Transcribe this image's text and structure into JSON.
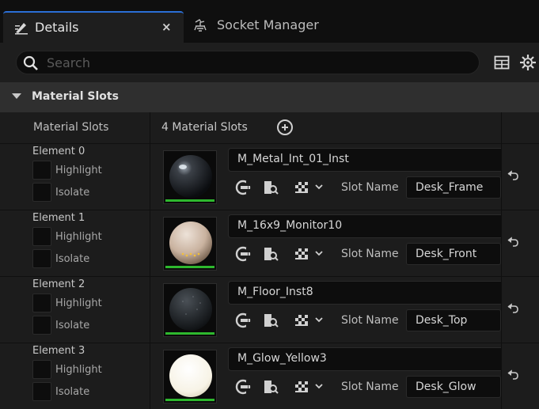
{
  "tabs": {
    "details_label": "Details",
    "close_glyph": "×",
    "socket_label": "Socket Manager"
  },
  "search": {
    "placeholder": "Search"
  },
  "category": {
    "label": "Material Slots"
  },
  "slots_row": {
    "label": "Material Slots",
    "value": "4 Material Slots"
  },
  "checkbox_labels": {
    "highlight": "Highlight",
    "isolate": "Isolate"
  },
  "slot_name_label": "Slot Name",
  "elements": [
    {
      "name": "Element 0",
      "material": "M_Metal_Int_01_Inst",
      "slot": "Desk_Frame"
    },
    {
      "name": "Element 1",
      "material": "M_16x9_Monitor10",
      "slot": "Desk_Front"
    },
    {
      "name": "Element 2",
      "material": "M_Floor_Inst8",
      "slot": "Desk_Top"
    },
    {
      "name": "Element 3",
      "material": "M_Glow_Yellow3",
      "slot": "Desk_Glow"
    }
  ],
  "colors": {
    "accent_tab": "#2b6fd6",
    "asset_bar": "#2eb82e"
  },
  "icons": [
    "details-icon",
    "socket-icon",
    "search-icon",
    "table-icon",
    "gear-icon",
    "add-icon",
    "browse-arrow-icon",
    "find-in-browser-icon",
    "checker-icon",
    "chevron-down-icon",
    "reset-arrow-icon"
  ]
}
